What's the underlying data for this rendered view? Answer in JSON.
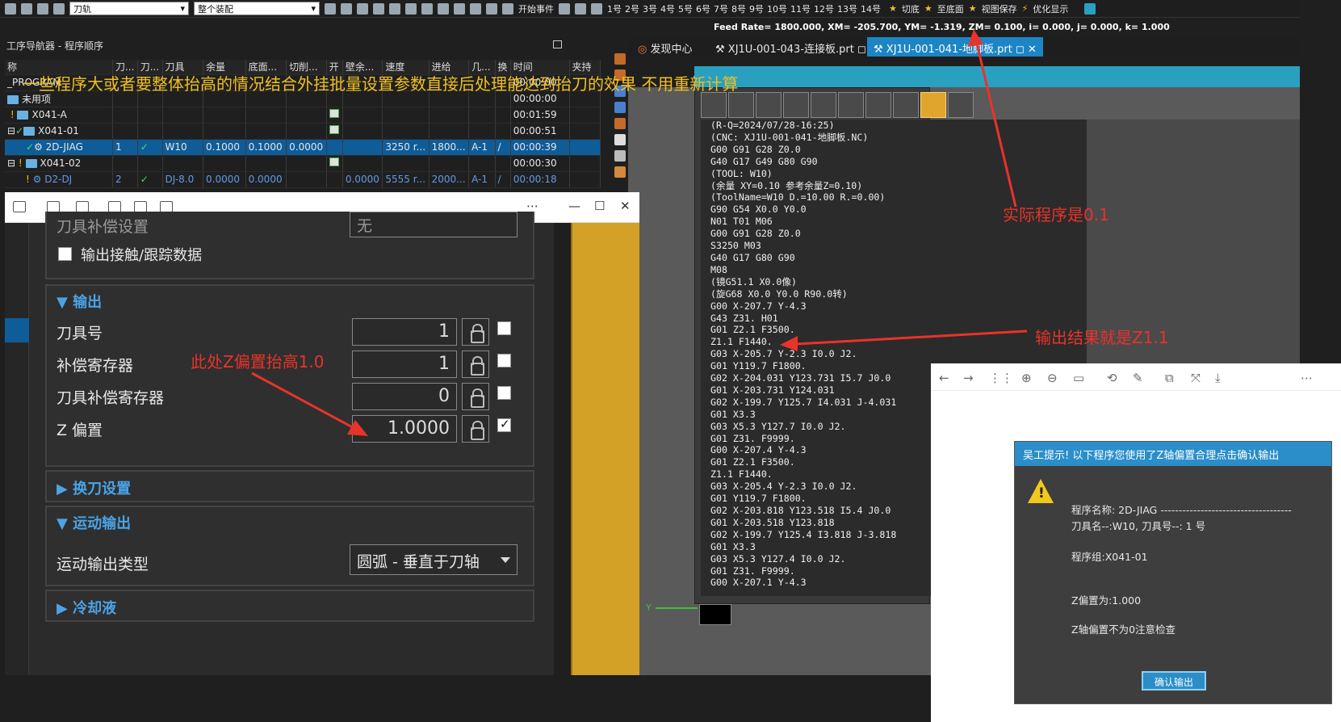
{
  "toolbar": {
    "combo1": "刀轨",
    "combo2": "整个装配",
    "start_event": "开始事件",
    "views": [
      "1号",
      "2号",
      "3号",
      "4号",
      "5号",
      "6号",
      "7号",
      "8号",
      "9号",
      "10号",
      "11号",
      "12号",
      "13号",
      "14号"
    ],
    "cut_face": "切底",
    "to_bottom": "至底面",
    "save_view": "视图保存",
    "optimize": "优化显示"
  },
  "feed_line": "Feed Rate= 1800.000, XM= -205.700, YM= -1.319, ZM= 0.100, i= 0.000, j= 0.000, k= 1.000",
  "navigator": {
    "title": "工序导航器 - 程序顺序",
    "headers": [
      "称",
      "刀...",
      "刀...",
      "刀具",
      "余量",
      "底面...",
      "切削...",
      "开",
      "壁余...",
      "速度",
      "进给",
      "几...",
      "换",
      "时间",
      "夹持"
    ],
    "rows": [
      {
        "name": "_PROGRAM",
        "time": "00:00:00"
      },
      {
        "name": "未用项",
        "time": "00:00:00"
      },
      {
        "name": "X041-A",
        "time": "00:01:59"
      },
      {
        "name": "X041-01",
        "time": "00:00:51"
      },
      {
        "name": "2D-JIAG",
        "no": "1",
        "tool": "W10",
        "stock": "0.1000",
        "floor": "0.1000",
        "cut": "0.0000",
        "speed": "3250 r...",
        "feed": "1800...",
        "geo": "A-1",
        "time": "00:00:39"
      },
      {
        "name": "X041-02",
        "time": "00:00:30"
      },
      {
        "name": "D2-DJ",
        "no": "2",
        "tool": "DJ-8.0",
        "stock": "0.0000",
        "floor": "0.0000",
        "wall": "0.0000",
        "speed": "5555 r...",
        "feed": "2000...",
        "geo": "A-1",
        "time": "00:00:18"
      }
    ]
  },
  "overlay_text": "一些程序大或者要整体抬高的情况结合外挂批量设置参数直接后处理能达到抬刀的效果  不用重新计算",
  "tool_params": {
    "comp_label": "刀具补偿设置",
    "comp_value": "无",
    "output_contact": "输出接触/跟踪数据",
    "output_section": "输出",
    "tool_number_label": "刀具号",
    "tool_number": "1",
    "comp_register_label": "补偿寄存器",
    "comp_register": "1",
    "tool_comp_register_label": "刀具补偿寄存器",
    "tool_comp_register": "0",
    "z_offset_label": "Z 偏置",
    "z_offset": "1.0000",
    "tool_change": "换刀设置",
    "motion_output": "运动输出",
    "motion_type_label": "运动输出类型",
    "motion_type": "圆弧 - 垂直于刀轴",
    "coolant": "冷却液"
  },
  "annotations": {
    "z_lift": "此处Z偏置抬高1.0",
    "actual": "实际程序是0.1",
    "output_z": "输出结果就是Z1.1"
  },
  "tabs": [
    "发现中心",
    "XJ1U-001-043-连接板.prt",
    "XJ1U-001-041-地脚板.prt"
  ],
  "nc_code": [
    "(R-Q=2024/07/28-16:25)",
    "(CNC: XJ1U-001-041-地脚板.NC)",
    "G00 G91 G28 Z0.0",
    "G40 G17 G49 G80 G90",
    "(TOOL: W10)",
    "(余量 XY=0.10 参考余量Z=0.10)",
    "(ToolName=W10 D.=10.00 R.=0.00)",
    "G90 G54 X0.0 Y0.0",
    "N01 T01 M06",
    "G00 G91 G28 Z0.0",
    "S3250 M03",
    "G40 G17 G80 G90",
    "M08",
    "(镜G51.1 X0.0像)",
    "(旋G68 X0.0 Y0.0 R90.0转)",
    "G00 X-207.7 Y-4.3",
    "G43 Z31. H01",
    "G01 Z2.1 F3500.",
    "Z1.1 F1440.",
    "G03 X-205.7 Y-2.3 I0.0 J2.",
    "G01 Y119.7 F1800.",
    "G02 X-204.031 Y123.731 I5.7 J0.0",
    "G01 X-203.731 Y124.031",
    "G02 X-199.7 Y125.7 I4.031 J-4.031",
    "G01 X3.3",
    "G03 X5.3 Y127.7 I0.0 J2.",
    "G01 Z31. F9999.",
    "G00 X-207.4 Y-4.3",
    "G01 Z2.1 F3500.",
    "Z1.1 F1440.",
    "G03 X-205.4 Y-2.3 I0.0 J2.",
    "G01 Y119.7 F1800.",
    "G02 X-203.818 Y123.518 I5.4 J0.0",
    "G01 X-203.518 Y123.818",
    "G02 X-199.7 Y125.4 I3.818 J-3.818",
    "G01 X3.3",
    "G03 X5.3 Y127.4 I0.0 J2.",
    "G01 Z31. F9999.",
    "G00 X-207.1 Y-4.3"
  ],
  "alert": {
    "title": "吴工提示! 以下程序您使用了Z轴偏置合理点击确认输出",
    "program": "程序名称: 2D-JIAG ------------------------------------",
    "tool": "刀具名--:W10,      刀具号--:   1 号",
    "group": "程序组:X041-01",
    "z_offset": "Z偏置为:1.000",
    "note": "Z轴偏置不为0注意检查",
    "confirm": "确认输出"
  },
  "axis_label": "Y"
}
